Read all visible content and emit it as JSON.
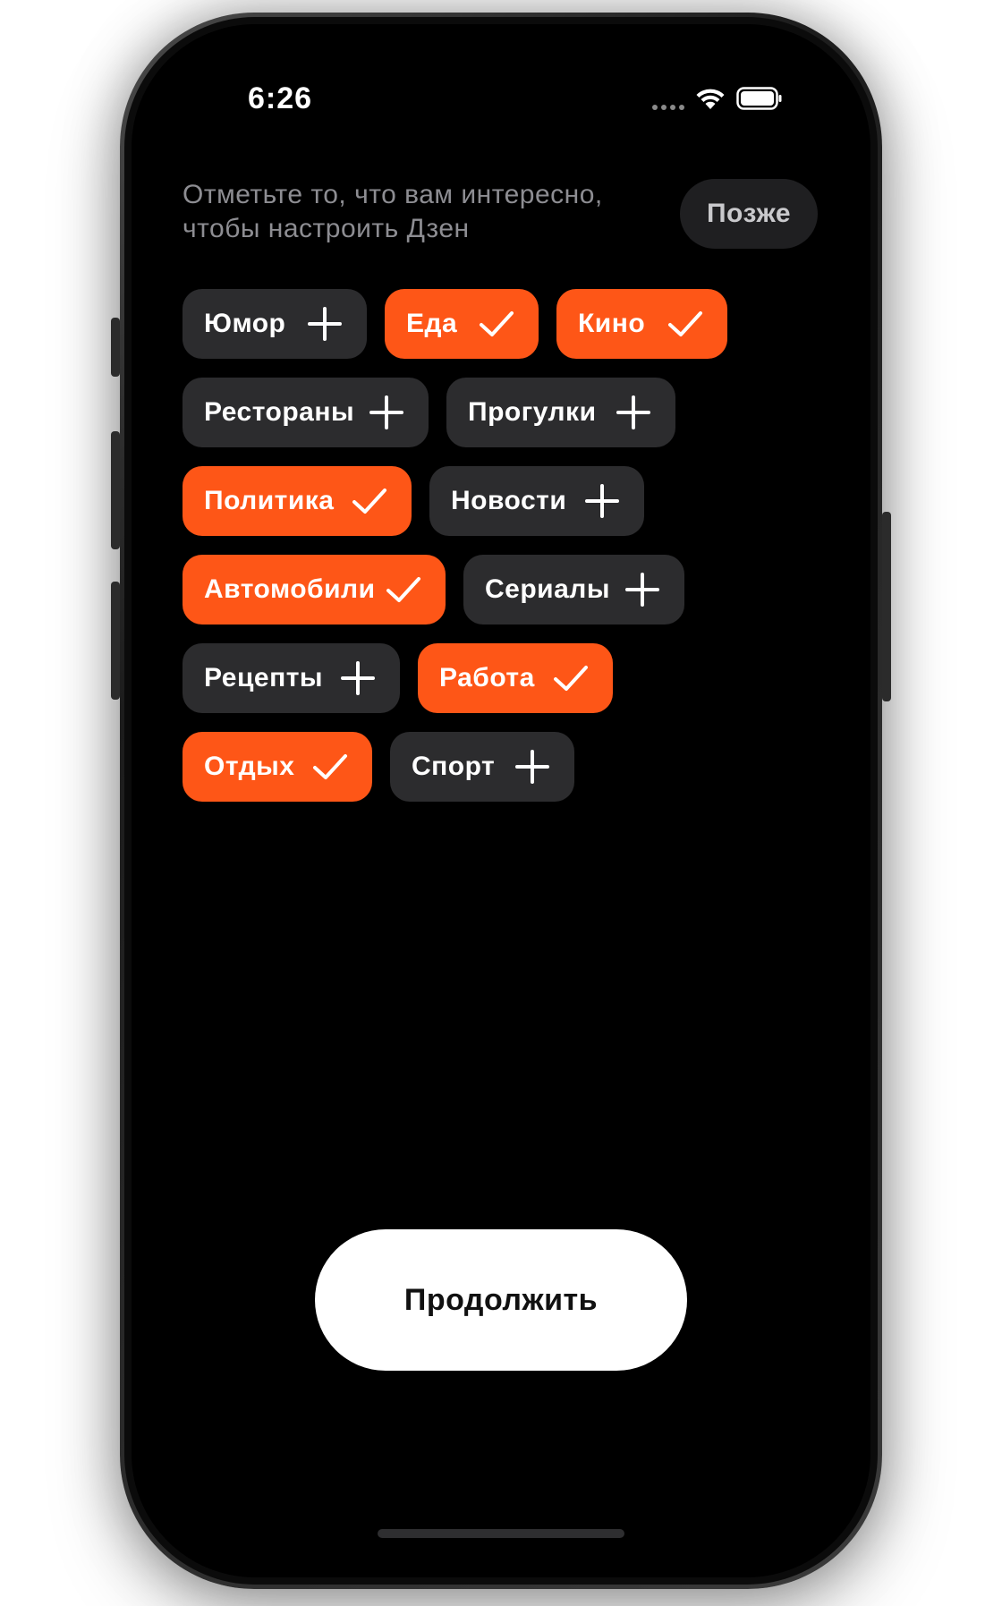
{
  "status_bar": {
    "time": "6:26",
    "icons": [
      "signal-dots-icon",
      "wifi-icon",
      "battery-icon"
    ]
  },
  "header": {
    "subtitle_line1": "Отметьте то, что вам интересно,",
    "subtitle_line2": "чтобы настроить Дзен",
    "later_label": "Позже"
  },
  "colors": {
    "selected_chip": "#fe5617",
    "unselected_chip": "#2c2c2e",
    "background": "#000000"
  },
  "topics": [
    {
      "label": "Юмор",
      "selected": false
    },
    {
      "label": "Еда",
      "selected": true
    },
    {
      "label": "Кино",
      "selected": true
    },
    {
      "label": "Рестораны",
      "selected": false
    },
    {
      "label": "Прогулки",
      "selected": false
    },
    {
      "label": "Политика",
      "selected": true
    },
    {
      "label": "Новости",
      "selected": false
    },
    {
      "label": "Автомобили",
      "selected": true
    },
    {
      "label": "Сериалы",
      "selected": false
    },
    {
      "label": "Рецепты",
      "selected": false
    },
    {
      "label": "Работа",
      "selected": true
    },
    {
      "label": "Отдых",
      "selected": true
    },
    {
      "label": "Спорт",
      "selected": false
    }
  ],
  "footer": {
    "continue_label": "Продолжить"
  }
}
